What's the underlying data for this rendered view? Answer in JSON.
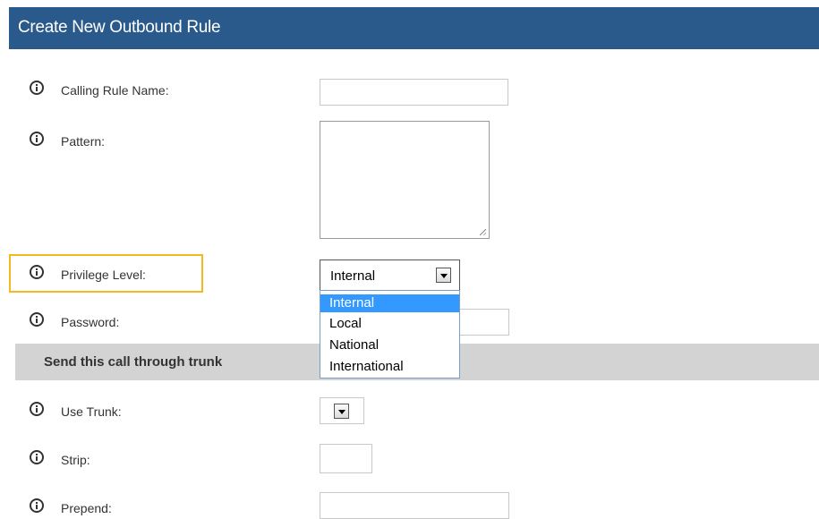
{
  "title": "Create New Outbound Rule",
  "fields": {
    "calling_rule_name": {
      "label": "Calling Rule Name:",
      "value": ""
    },
    "pattern": {
      "label": "Pattern:",
      "value": ""
    },
    "privilege_level": {
      "label": "Privilege Level:",
      "value": "Internal"
    },
    "password": {
      "label": "Password:",
      "value": ""
    },
    "use_trunk": {
      "label": "Use Trunk:",
      "value": ""
    },
    "strip": {
      "label": "Strip:",
      "value": ""
    },
    "prepend": {
      "label": "Prepend:",
      "value": ""
    }
  },
  "section": {
    "label": "Send this call through trunk"
  },
  "privilege_options": [
    "Internal",
    "Local",
    "National",
    "International"
  ],
  "privilege_selected_index": 0,
  "colors": {
    "header_bg": "#2a5a8c",
    "highlight_border": "#f5b820",
    "selected_option_bg": "#3399ff",
    "section_bg": "#d3d3d3"
  },
  "icons": {
    "field_info": "info-icon"
  }
}
